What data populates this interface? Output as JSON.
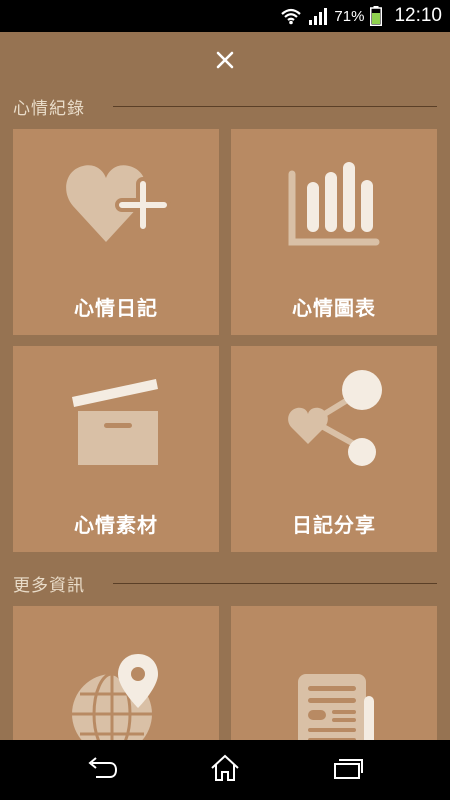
{
  "status_bar": {
    "battery_percent": "71%",
    "time": "12:10",
    "icons": [
      "wifi-icon",
      "signal-icon",
      "battery-icon"
    ]
  },
  "header": {
    "close_icon": "close-icon"
  },
  "sections": [
    {
      "title": "心情紀錄",
      "tiles": [
        {
          "label": "心情日記",
          "icon": "heart-plus-icon"
        },
        {
          "label": "心情圖表",
          "icon": "bar-chart-icon"
        },
        {
          "label": "心情素材",
          "icon": "box-icon"
        },
        {
          "label": "日記分享",
          "icon": "share-heart-icon"
        }
      ]
    },
    {
      "title": "更多資訊",
      "tiles": [
        {
          "label": "",
          "icon": "globe-pin-icon"
        },
        {
          "label": "",
          "icon": "newspaper-icon"
        }
      ]
    }
  ],
  "nav_bar": {
    "icons": [
      "back-icon",
      "home-icon",
      "recent-apps-icon"
    ]
  },
  "colors": {
    "background": "#967352",
    "tile": "#b88a63",
    "icon_light": "#d9c0a6",
    "icon_white": "#f4ece2"
  }
}
